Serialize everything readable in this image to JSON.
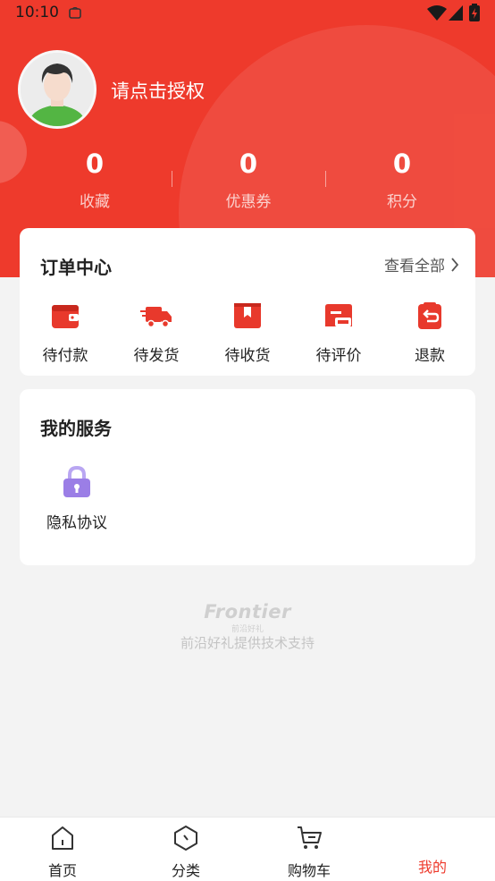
{
  "status_bar": {
    "time": "10:10"
  },
  "profile": {
    "name": "请点击授权"
  },
  "stats": [
    {
      "value": "0",
      "label": "收藏"
    },
    {
      "value": "0",
      "label": "优惠券"
    },
    {
      "value": "0",
      "label": "积分"
    }
  ],
  "orders": {
    "title": "订单中心",
    "view_all": "查看全部",
    "items": [
      {
        "label": "待付款",
        "icon": "wallet-icon"
      },
      {
        "label": "待发货",
        "icon": "delivery-truck-icon"
      },
      {
        "label": "待收货",
        "icon": "package-icon"
      },
      {
        "label": "待评价",
        "icon": "review-icon"
      },
      {
        "label": "退款",
        "icon": "refund-icon"
      }
    ]
  },
  "services": {
    "title": "我的服务",
    "items": [
      {
        "label": "隐私协议",
        "icon": "lock-icon"
      }
    ]
  },
  "footer": {
    "brand": "Frontier",
    "brand_sub": "前沿好礼",
    "tagline": "前沿好礼提供技术支持"
  },
  "tabs": [
    {
      "label": "首页",
      "icon": "home-icon"
    },
    {
      "label": "分类",
      "icon": "category-icon"
    },
    {
      "label": "购物车",
      "icon": "cart-icon"
    },
    {
      "label": "我的",
      "icon": "profile-icon",
      "active": true
    }
  ],
  "colors": {
    "accent": "#ee3a2c",
    "lock": "#9b7ee6"
  }
}
